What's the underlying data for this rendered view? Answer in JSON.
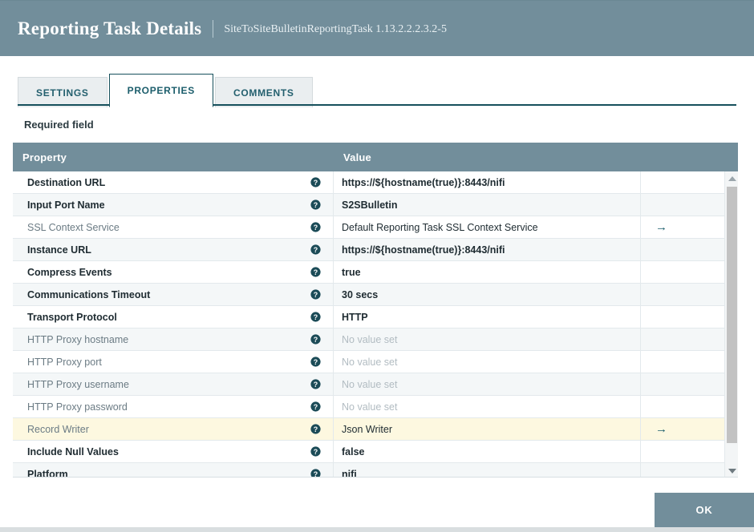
{
  "header": {
    "title": "Reporting Task Details",
    "subtitle": "SiteToSiteBulletinReportingTask 1.13.2.2.2.3.2-5"
  },
  "tabs": [
    {
      "label": "SETTINGS",
      "active": false
    },
    {
      "label": "PROPERTIES",
      "active": true
    },
    {
      "label": "COMMENTS",
      "active": false
    }
  ],
  "required_field_label": "Required field",
  "table": {
    "columns": {
      "property": "Property",
      "value": "Value"
    },
    "value_placeholder": "No value set",
    "go_to_icon": "arrow-right-icon",
    "help_icon": "help-circle-icon",
    "rows": [
      {
        "property": "Destination URL",
        "value": "https://${hostname(true)}:8443/nifi",
        "required": true,
        "has_value": true,
        "goto": false,
        "selected": false
      },
      {
        "property": "Input Port Name",
        "value": "S2SBulletin",
        "required": true,
        "has_value": true,
        "goto": false,
        "selected": false
      },
      {
        "property": "SSL Context Service",
        "value": "Default Reporting Task SSL Context Service",
        "required": false,
        "has_value": true,
        "goto": true,
        "selected": false
      },
      {
        "property": "Instance URL",
        "value": "https://${hostname(true)}:8443/nifi",
        "required": true,
        "has_value": true,
        "goto": false,
        "selected": false
      },
      {
        "property": "Compress Events",
        "value": "true",
        "required": true,
        "has_value": true,
        "goto": false,
        "selected": false
      },
      {
        "property": "Communications Timeout",
        "value": "30 secs",
        "required": true,
        "has_value": true,
        "goto": false,
        "selected": false
      },
      {
        "property": "Transport Protocol",
        "value": "HTTP",
        "required": true,
        "has_value": true,
        "goto": false,
        "selected": false
      },
      {
        "property": "HTTP Proxy hostname",
        "value": "No value set",
        "required": false,
        "has_value": false,
        "goto": false,
        "selected": false
      },
      {
        "property": "HTTP Proxy port",
        "value": "No value set",
        "required": false,
        "has_value": false,
        "goto": false,
        "selected": false
      },
      {
        "property": "HTTP Proxy username",
        "value": "No value set",
        "required": false,
        "has_value": false,
        "goto": false,
        "selected": false
      },
      {
        "property": "HTTP Proxy password",
        "value": "No value set",
        "required": false,
        "has_value": false,
        "goto": false,
        "selected": false
      },
      {
        "property": "Record Writer",
        "value": "Json Writer",
        "required": false,
        "has_value": true,
        "goto": true,
        "selected": true
      },
      {
        "property": "Include Null Values",
        "value": "false",
        "required": true,
        "has_value": true,
        "goto": false,
        "selected": false
      },
      {
        "property": "Platform",
        "value": "nifi",
        "required": true,
        "has_value": true,
        "goto": false,
        "selected": false
      }
    ]
  },
  "footer": {
    "ok_label": "OK"
  },
  "colors": {
    "header_bg": "#728e9b",
    "table_header_bg": "#728e9b",
    "accent": "#16505c",
    "selected_row": "#fdf8e0",
    "alt_row": "#f4f7f8"
  }
}
